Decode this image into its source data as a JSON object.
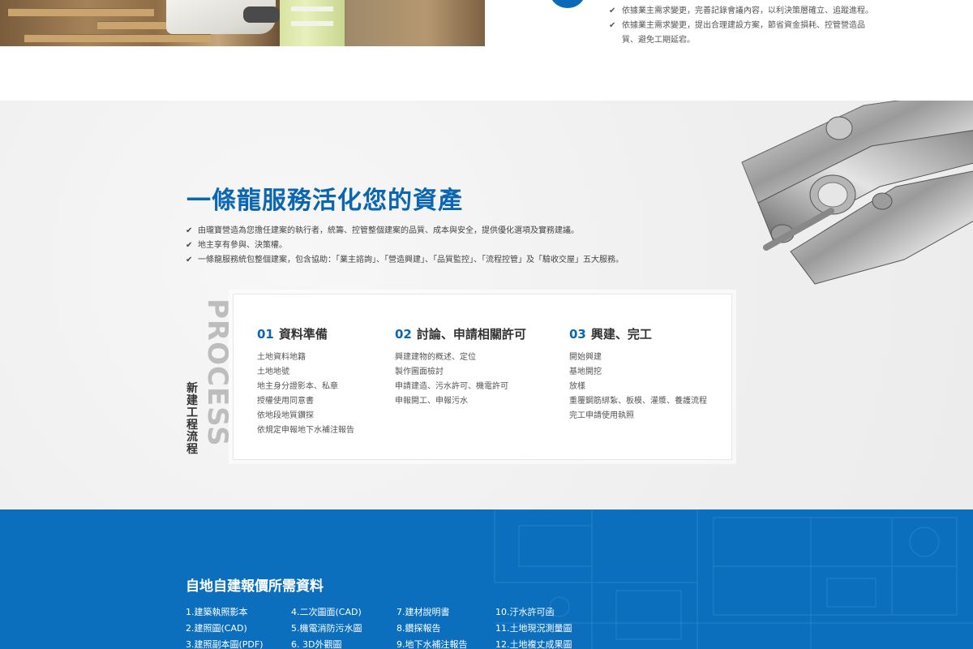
{
  "top": {
    "checklist": [
      "依據業主需求變更，完善記錄會議內容，以利決策層確立、追蹤進程。",
      "依據業主需求變更，提出合理建設方案，節省資金損耗、控管營造品質、避免工期延宕。"
    ]
  },
  "services": {
    "title": "一條龍服務活化您的資產",
    "bullets": [
      "由瓏寶營造為您擔任建案的執行者，統籌、控管整個建案的品質、成本與安全，提供優化選項及實務建議。",
      "地主享有參與、決策權。",
      "一條龍服務統包整個建案，包含協助：「業主諮詢」、「營造興建」、「品質監控」、「流程控管」及「驗收交屋」五大服務。"
    ]
  },
  "process": {
    "label": "新建工程流程",
    "watermark": "PROCESS",
    "steps": [
      {
        "num": "01",
        "title": "資料準備",
        "items": [
          "土地資料地籍",
          "土地地號",
          "地主身分證影本、私章",
          "授權使用同意書",
          "依地段地質鑽探",
          "依規定申報地下水補注報告"
        ]
      },
      {
        "num": "02",
        "title": "討論、申請相關許可",
        "items": [
          "興建建物的概述、定位",
          "製作圖面檢討",
          "申請建造、污水許可、機電許可",
          "申報開工、申報污水"
        ]
      },
      {
        "num": "03",
        "title": "興建、完工",
        "items": [
          "開始興建",
          "基地開挖",
          "放樣",
          "重覆鋼筋綁紮、板模、灌漿、養護流程",
          "完工申請使用執照"
        ]
      }
    ]
  },
  "quote": {
    "title": "自地自建報價所需資料",
    "columns": [
      [
        "1.建築執照影本",
        "2.建照圖(CAD)",
        "3.建照副本圖(PDF)"
      ],
      [
        "4.二次圖面(CAD)",
        "5.機電消防污水圖",
        "6. 3D外觀圖"
      ],
      [
        "7.建材說明書",
        "8.鑽探報告",
        "9.地下水補注報告"
      ],
      [
        "10.汙水許可函",
        "11.土地現況測量圖",
        "12.土地複丈成果圖"
      ]
    ]
  },
  "colors": {
    "brand_blue": "#0a66b0",
    "quote_bg": "#0b6fbd"
  }
}
